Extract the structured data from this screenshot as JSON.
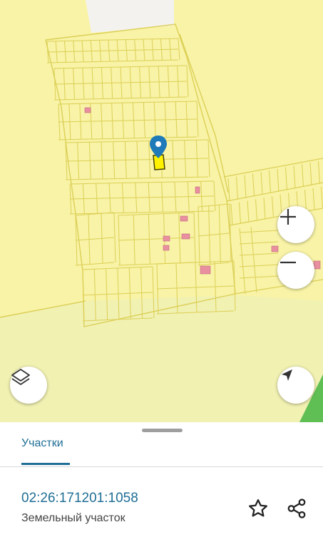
{
  "map": {
    "controls": {
      "zoom_in_icon": "plus-icon",
      "zoom_out_icon": "minus-icon",
      "layers_icon": "layers-icon",
      "locate_icon": "navigation-arrow-icon"
    },
    "marker_icon": "location-pin-icon",
    "colors": {
      "land": "#f8f3a6",
      "parcel_lines": "#dccf57",
      "buildings": "#e98fa0",
      "selected_parcel": "#fff200",
      "marker": "#1e7ab8",
      "unmapped_area": "#f4f2ee",
      "field": "#f1f1b2",
      "forest": "#5fbf55"
    }
  },
  "sheet": {
    "tabs": [
      {
        "label": "Участки",
        "active": true
      }
    ],
    "parcel": {
      "cadastral_number": "02:26:171201:1058",
      "type": "Земельный участок"
    },
    "actions": {
      "favorite_icon": "star-outline-icon",
      "share_icon": "share-icon"
    }
  }
}
